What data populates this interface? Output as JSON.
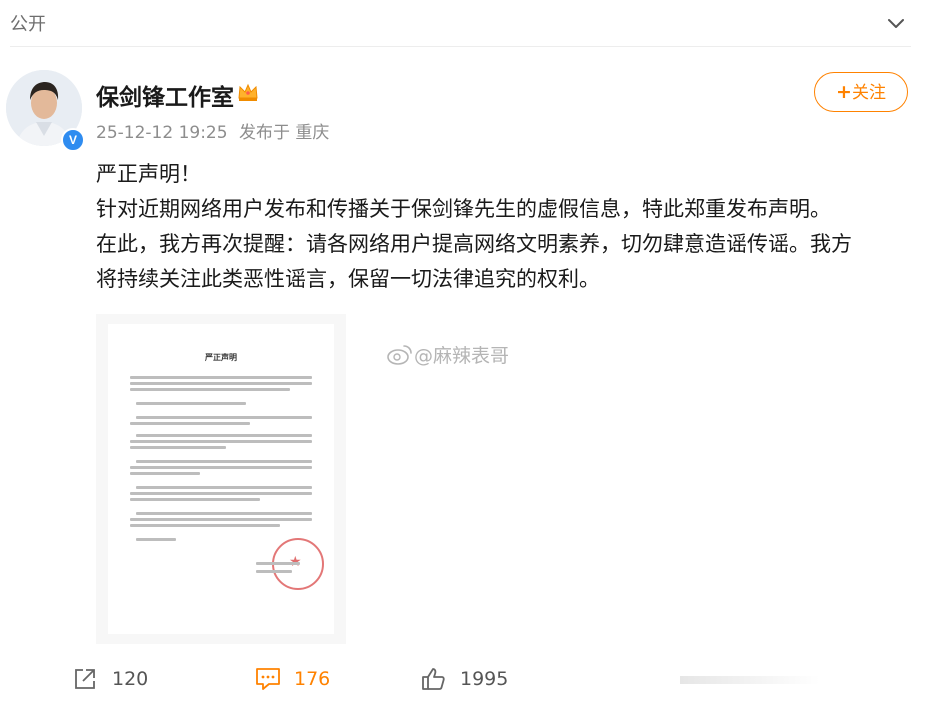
{
  "header": {
    "visibility_label": "公开",
    "collapse_icon": "chevron-down-icon"
  },
  "post": {
    "author": "保剑锋工作室",
    "timestamp": "25-12-12 19:25",
    "source": "发布于 重庆",
    "follow_label": "关注",
    "follow_prefix": "+",
    "verified_mark": "V",
    "lines": [
      "严正声明！",
      "针对近期网络用户发布和传播关于保剑锋先生的虚假信息，特此郑重发布声明。",
      "在此，我方再次提醒：请各网络用户提高网络文明素养，切勿肆意造谣传谣。我方",
      "将持续关注此类恶性谣言，保留一切法律追究的权利。"
    ],
    "image_doc_title": "严正声明",
    "watermark": "@麻辣表哥"
  },
  "actions": {
    "share_count": "120",
    "comment_count": "176",
    "like_count": "1995"
  },
  "colors": {
    "accent": "#ff8200",
    "verified": "#2f8cf0",
    "text": "#1a1a1a",
    "meta": "#8d8d8d"
  }
}
